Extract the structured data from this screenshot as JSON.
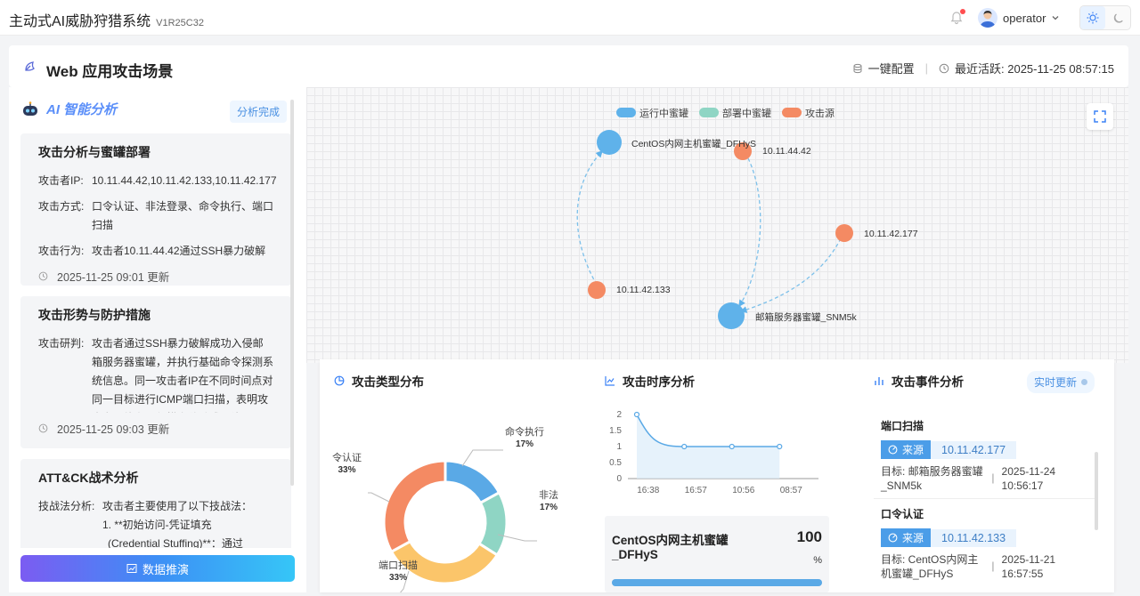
{
  "app": {
    "title": "主动式AI威胁狩猎系统",
    "version": "V1R25C32"
  },
  "user": {
    "name": "operator"
  },
  "header": {
    "scene_title": "Web 应用攻击场景",
    "config_label": "一键配置",
    "last_active": "最近活跃: 2025-11-25 08:57:15"
  },
  "ai_panel": {
    "title": "AI 智能分析",
    "status": "分析完成",
    "cards": [
      {
        "title": "攻击分析与蜜罐部署",
        "rows": [
          {
            "k": "攻击者IP:",
            "v": "10.11.44.42,10.11.42.133,10.11.42.177"
          },
          {
            "k": "攻击方式:",
            "v": "口令认证、非法登录、命令执行、端口扫描"
          },
          {
            "k": "攻击行为:",
            "v": "攻击者10.11.44.42通过SSH暴力破解"
          }
        ],
        "time": "2025-11-25 09:01 更新"
      },
      {
        "title": "攻击形势与防护措施",
        "rows": [
          {
            "k": "攻击研判:",
            "v": "攻击者通过SSH暴力破解成功入侵邮箱服务器蜜罐，并执行基础命令探测系统信息。同一攻击者IP在不同时间点对同一目标进行ICMP端口扫描，表明攻击者可能在进行横向移动或网络"
          }
        ],
        "time": "2025-11-25 09:03 更新"
      },
      {
        "title": "ATT&CK战术分析",
        "rows": [
          {
            "k": "技战法分析:",
            "v": "攻击者主要使用了以下技战法："
          }
        ],
        "extra1": "1. **初始访问-凭证填充",
        "extra2": "(Credential Stuffing)**：通过"
      }
    ],
    "button": "数据推演"
  },
  "graph": {
    "legend": [
      "运行中蜜罐",
      "部署中蜜罐",
      "攻击源"
    ],
    "colors": {
      "running": "#5fb2ea",
      "deploying": "#8fd5c4",
      "attacker": "#f48a63"
    },
    "nodes": {
      "honeypot1": "CentOS内网主机蜜罐_DFHyS",
      "honeypot2": "邮箱服务器蜜罐_SNM5k",
      "attacker1": "10.11.44.42",
      "attacker2": "10.11.42.177",
      "attacker3": "10.11.42.133"
    }
  },
  "attack_types": {
    "title": "攻击类型分布",
    "chart_data": {
      "type": "pie",
      "categories": [
        "命令执行",
        "非法",
        "端口扫描",
        "令认证"
      ],
      "values": [
        17,
        17,
        33,
        33
      ],
      "labels": [
        "17%",
        "17%",
        "33%",
        "33%"
      ],
      "colors": [
        "#5aa9e6",
        "#8fd5c4",
        "#fbc56a",
        "#f48a63"
      ]
    }
  },
  "timeline": {
    "title": "攻击时序分析",
    "chart_data": {
      "type": "line",
      "x": [
        "16:38",
        "16:57",
        "10:56",
        "08:57"
      ],
      "values": [
        2,
        1,
        1,
        1
      ],
      "yticks": [
        "0",
        "0.5",
        "1",
        "1.5",
        "2"
      ],
      "ylim": [
        0,
        2
      ]
    },
    "stat": {
      "name": "CentOS内网主机蜜罐_DFHyS",
      "value": "100",
      "unit": "%",
      "progress": 1.0
    }
  },
  "events": {
    "title": "攻击事件分析",
    "badge": "实时更新",
    "items": [
      {
        "title": "端口扫描",
        "src_label": "来源",
        "ip": "10.11.42.177",
        "target": "目标: 邮箱服务器蜜罐_SNM5k",
        "time": "2025-11-24 10:56:17"
      },
      {
        "title": "口令认证",
        "src_label": "来源",
        "ip": "10.11.42.133",
        "target": "目标: CentOS内网主机蜜罐_DFHyS",
        "time": "2025-11-21 16:57:55"
      }
    ]
  }
}
